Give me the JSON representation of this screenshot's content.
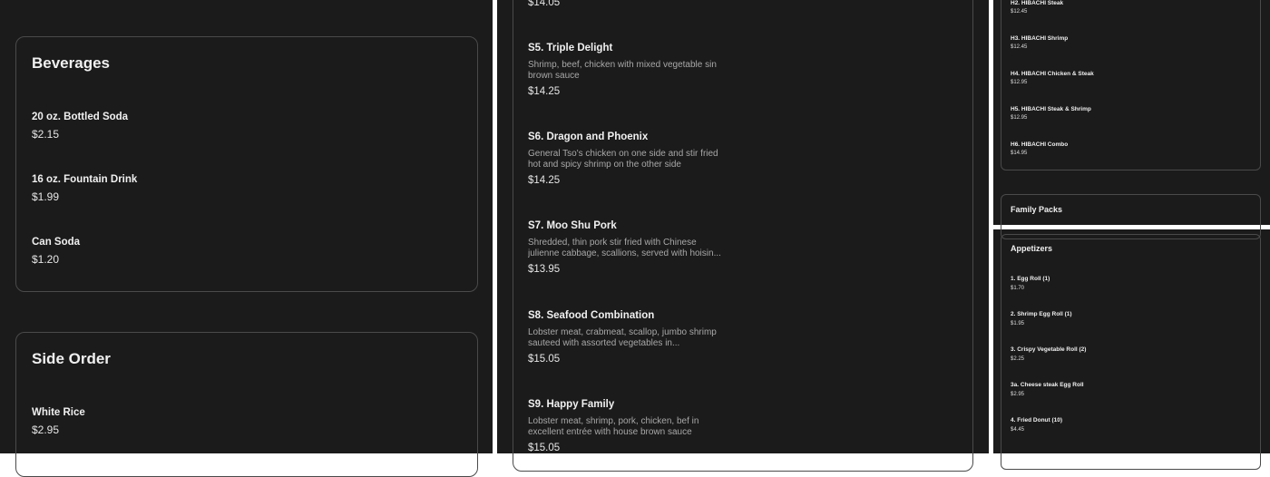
{
  "left": {
    "beverages": {
      "title": "Beverages",
      "items": [
        {
          "name": "20 oz. Bottled Soda",
          "price": "$2.15"
        },
        {
          "name": "16 oz. Fountain Drink",
          "price": "$1.99"
        },
        {
          "name": "Can Soda",
          "price": "$1.20"
        }
      ]
    },
    "side_order": {
      "title": "Side Order",
      "items": [
        {
          "name": "White Rice",
          "price": "$2.95"
        }
      ]
    }
  },
  "middle": {
    "top_price": "$14.05",
    "items": [
      {
        "name": "S5. Triple Delight",
        "desc": "Shrimp, beef, chicken with mixed vegetable sin brown sauce",
        "price": "$14.25"
      },
      {
        "name": "S6. Dragon and Phoenix",
        "desc": "General Tso's chicken on one side and stir fried hot and spicy shrimp on the other side",
        "price": "$14.25"
      },
      {
        "name": "S7. Moo Shu Pork",
        "desc": "Shredded, thin pork stir fried with Chinese julienne cabbage, scallions, served with hoisin...",
        "price": "$13.95"
      },
      {
        "name": "S8. Seafood Combination",
        "desc": "Lobster meat, crabmeat, scallop, jumbo shrimp sauteed with assorted vegetables in...",
        "price": "$15.05"
      },
      {
        "name": "S9. Happy Family",
        "desc": "Lobster meat, shrimp, pork, chicken, bef in excellent entrée with house brown sauce",
        "price": "$15.05"
      }
    ]
  },
  "right_top": {
    "items": [
      {
        "name": "H2. HIBACHI Steak",
        "price": "$12.45"
      },
      {
        "name": "H3. HIBACHI Shrimp",
        "price": "$12.45"
      },
      {
        "name": "H4. HIBACHI Chicken & Steak",
        "price": "$12.95"
      },
      {
        "name": "H5. HIBACHI Steak & Shrimp",
        "price": "$12.95"
      },
      {
        "name": "H6. HIBACHI Combo",
        "price": "$14.95"
      }
    ],
    "family_packs": "Family Packs"
  },
  "right_bottom": {
    "title": "Appetizers",
    "items": [
      {
        "name": "1. Egg Roll (1)",
        "price": "$1.70"
      },
      {
        "name": "2. Shrimp Egg Roll (1)",
        "price": "$1.95"
      },
      {
        "name": "3. Crispy Vegetable Roll (2)",
        "price": "$2.25"
      },
      {
        "name": "3a. Cheese steak Egg Roll",
        "price": "$2.95"
      },
      {
        "name": "4. Fried Donut (10)",
        "price": "$4.45"
      }
    ]
  }
}
